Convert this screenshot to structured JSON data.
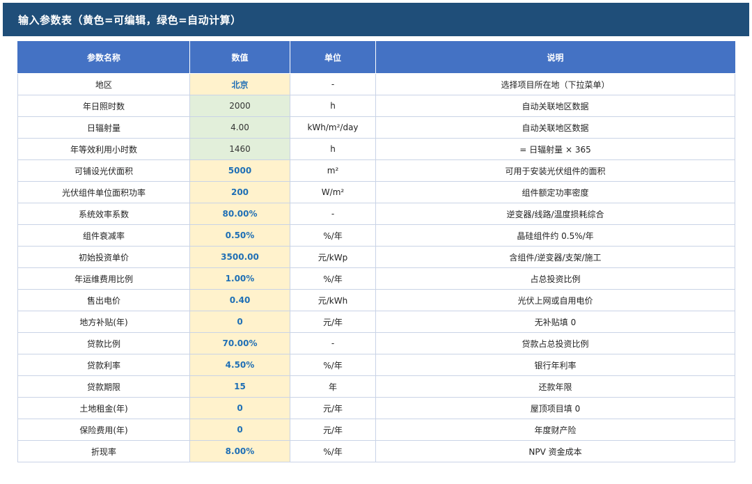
{
  "header": {
    "title": "输入参数表（黄色=可编辑，绿色=自动计算）"
  },
  "colors": {
    "header_bg": "#1f4e79",
    "table_header_bg": "#4472c4",
    "editable_bg": "#fff2cc",
    "auto_bg": "#e2efda",
    "editable_text": "#1f6fb5"
  },
  "table": {
    "columns": [
      "参数名称",
      "数值",
      "单位",
      "说明"
    ],
    "rows": [
      {
        "name": "地区",
        "value": "北京",
        "unit": "-",
        "desc": "选择项目所在地（下拉菜单）",
        "kind": "edit"
      },
      {
        "name": "年日照时数",
        "value": "2000",
        "unit": "h",
        "desc": "自动关联地区数据",
        "kind": "auto"
      },
      {
        "name": "日辐射量",
        "value": "4.00",
        "unit": "kWh/m²/day",
        "desc": "自动关联地区数据",
        "kind": "auto"
      },
      {
        "name": "年等效利用小时数",
        "value": "1460",
        "unit": "h",
        "desc": "= 日辐射量 × 365",
        "kind": "auto"
      },
      {
        "name": "可铺设光伏面积",
        "value": "5000",
        "unit": "m²",
        "desc": "可用于安装光伏组件的面积",
        "kind": "edit"
      },
      {
        "name": "光伏组件单位面积功率",
        "value": "200",
        "unit": "W/m²",
        "desc": "组件额定功率密度",
        "kind": "edit"
      },
      {
        "name": "系统效率系数",
        "value": "80.00%",
        "unit": "-",
        "desc": "逆变器/线路/温度损耗综合",
        "kind": "edit"
      },
      {
        "name": "组件衰减率",
        "value": "0.50%",
        "unit": "%/年",
        "desc": "晶硅组件约 0.5%/年",
        "kind": "edit"
      },
      {
        "name": "初始投资单价",
        "value": "3500.00",
        "unit": "元/kWp",
        "desc": "含组件/逆变器/支架/施工",
        "kind": "edit"
      },
      {
        "name": "年运维费用比例",
        "value": "1.00%",
        "unit": "%/年",
        "desc": "占总投资比例",
        "kind": "edit"
      },
      {
        "name": "售出电价",
        "value": "0.40",
        "unit": "元/kWh",
        "desc": "光伏上网或自用电价",
        "kind": "edit"
      },
      {
        "name": "地方补贴(年)",
        "value": "0",
        "unit": "元/年",
        "desc": "无补贴填 0",
        "kind": "edit"
      },
      {
        "name": "贷款比例",
        "value": "70.00%",
        "unit": "-",
        "desc": "贷款占总投资比例",
        "kind": "edit"
      },
      {
        "name": "贷款利率",
        "value": "4.50%",
        "unit": "%/年",
        "desc": "银行年利率",
        "kind": "edit"
      },
      {
        "name": "贷款期限",
        "value": "15",
        "unit": "年",
        "desc": "还款年限",
        "kind": "edit"
      },
      {
        "name": "土地租金(年)",
        "value": "0",
        "unit": "元/年",
        "desc": "屋顶项目填 0",
        "kind": "edit"
      },
      {
        "name": "保险费用(年)",
        "value": "0",
        "unit": "元/年",
        "desc": "年度财产险",
        "kind": "edit"
      },
      {
        "name": "折现率",
        "value": "8.00%",
        "unit": "%/年",
        "desc": "NPV 资金成本",
        "kind": "edit"
      }
    ]
  }
}
